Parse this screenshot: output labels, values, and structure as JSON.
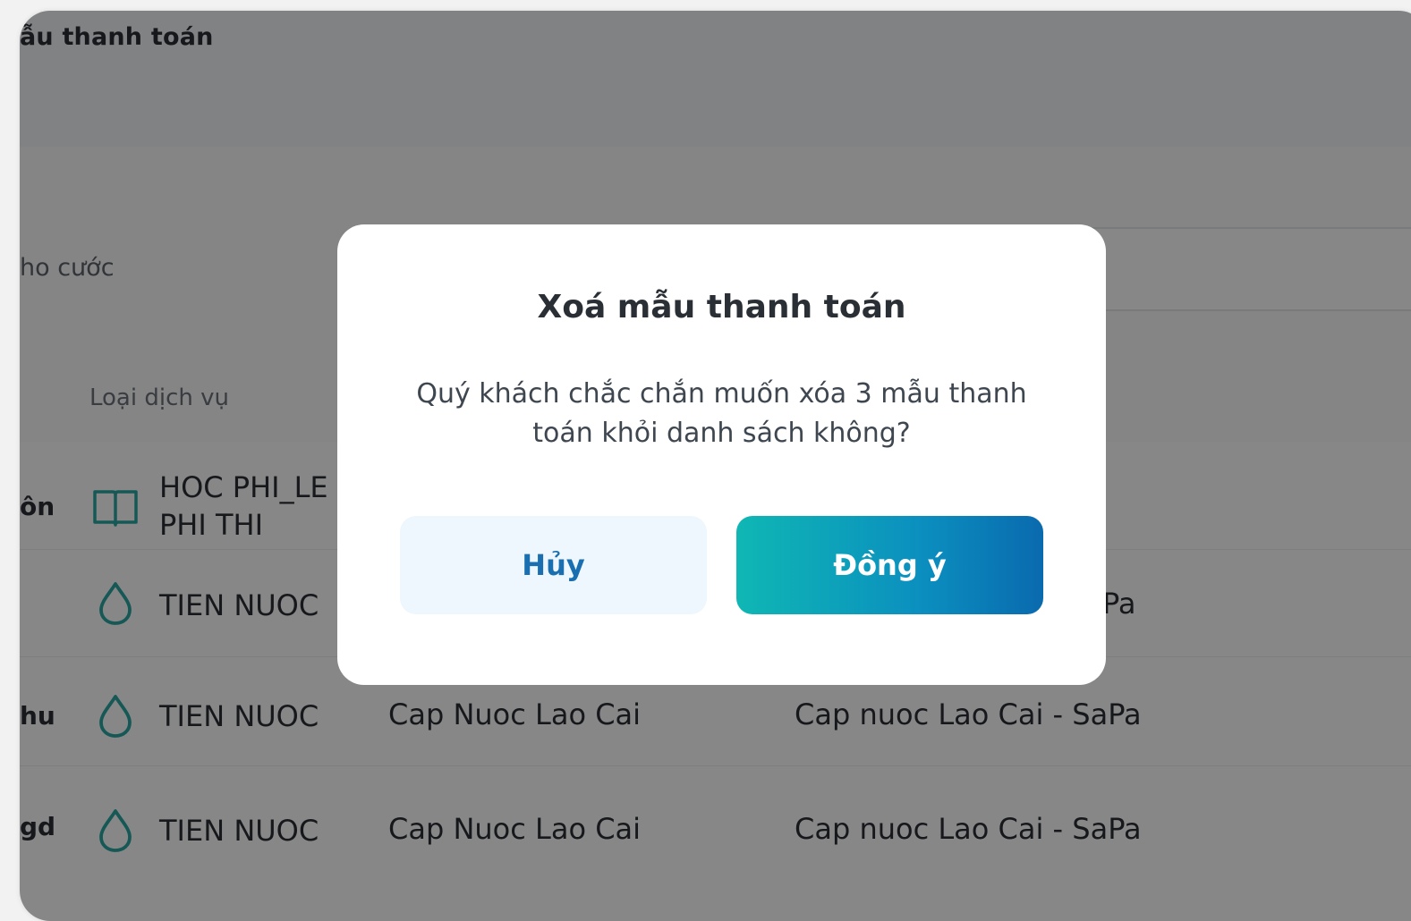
{
  "header": {
    "title": "ẫu thanh toán"
  },
  "filter": {
    "label": "ho cước"
  },
  "table": {
    "column_header": "Loại dịch vụ",
    "rows": [
      {
        "label": "ôn",
        "icon": "book-icon",
        "name_line1": "HOC PHI_LE",
        "name_line2": "PHI THI",
        "provider": "",
        "detail": ""
      },
      {
        "label": "",
        "icon": "water-drop-icon",
        "name": "TIEN NUOC",
        "provider": "",
        "detail": "Pa"
      },
      {
        "label": "hu",
        "icon": "water-drop-icon",
        "name": "TIEN NUOC",
        "provider": "Cap Nuoc Lao Cai",
        "detail": "Cap nuoc Lao Cai - SaPa"
      },
      {
        "label": "gd",
        "icon": "water-drop-icon",
        "name": "TIEN NUOC",
        "provider": "Cap Nuoc Lao Cai",
        "detail": "Cap nuoc Lao Cai - SaPa"
      }
    ]
  },
  "dialog": {
    "title": "Xoá mẫu thanh toán",
    "message_line1": "Quý khách chắc chắn muốn xóa 3 mẫu thanh",
    "message_line2": "toán khỏi danh sách không?",
    "cancel_label": "Hủy",
    "confirm_label": "Đồng ý"
  },
  "colors": {
    "accent_start": "#0fb7b4",
    "accent_end": "#0a6aae",
    "cancel_bg": "#eef7fd",
    "cancel_text": "#1a6fb0",
    "icon_teal": "#2aa6a0"
  }
}
